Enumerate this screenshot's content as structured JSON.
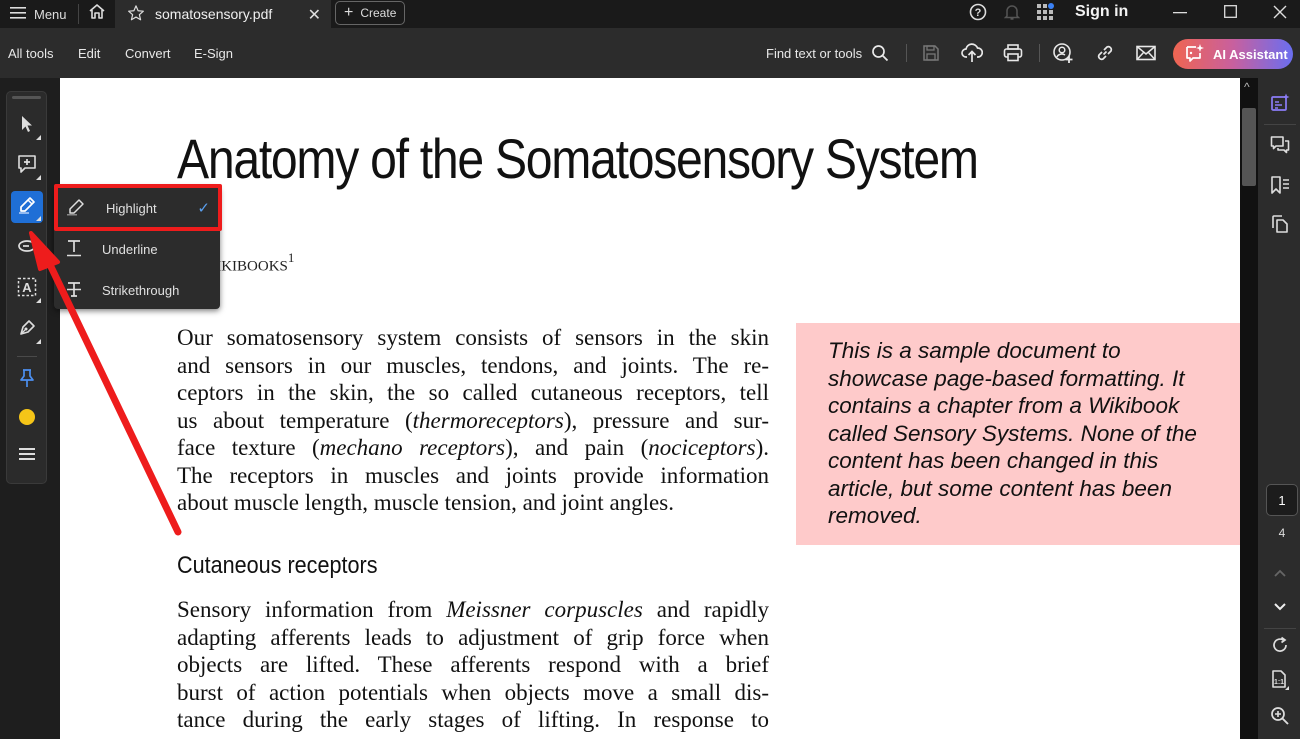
{
  "titlebar": {
    "menu_label": "Menu",
    "tab_title": "somatosensory.pdf",
    "create_label": "Create",
    "sign_in_label": "Sign in",
    "notification_dot_color": "#3b82f6"
  },
  "toolbar": {
    "menu_items": [
      "All tools",
      "Edit",
      "Convert",
      "E-Sign"
    ],
    "find_label": "Find text or tools",
    "ai_assistant_label": "AI Assistant"
  },
  "left_rail": {
    "tools": [
      {
        "name": "select",
        "icon": "cursor-arrow-icon"
      },
      {
        "name": "add-comment",
        "icon": "comment-plus-icon"
      },
      {
        "name": "highlight",
        "icon": "highlighter-pen-icon",
        "active": true
      },
      {
        "name": "draw-shape",
        "icon": "lasso-oval-icon"
      },
      {
        "name": "add-text",
        "icon": "text-box-icon"
      },
      {
        "name": "draw-freehand",
        "icon": "pen-draw-icon"
      },
      {
        "name": "pin",
        "icon": "pushpin-icon"
      },
      {
        "name": "color",
        "icon": "color-dot-icon",
        "color": "#f5c518"
      },
      {
        "name": "more",
        "icon": "menu-lines-icon"
      }
    ]
  },
  "popup_menu": {
    "items": [
      {
        "label": "Highlight",
        "icon": "highlighter-icon",
        "checked": true
      },
      {
        "label": "Underline",
        "icon": "underline-T-icon",
        "checked": false
      },
      {
        "label": "Strikethrough",
        "icon": "strikethrough-T-icon",
        "checked": false
      }
    ],
    "check_glyph": "✓"
  },
  "document": {
    "title": "Anatomy of the Somatosensory System",
    "author_visible": "m Wikibooks",
    "author_footnote": "1",
    "paragraph1_lines": [
      "Our somatosensory system consists of sensors in the skin",
      "and sensors in our muscles, tendons, and joints. The re-",
      "ceptors in the skin, the so called cutaneous receptors, tell",
      "us about temperature (thermoreceptors), pressure and sur-",
      "face texture (mechano receptors), and pain (nociceptors).",
      "The receptors in muscles and joints provide information",
      "about muscle length, muscle tension, and joint angles."
    ],
    "section_heading": "Cutaneous receptors",
    "paragraph2_lines": [
      "Sensory information from Meissner corpuscles and rapidly",
      "adapting afferents leads to adjustment of grip force when",
      "objects are lifted. These afferents respond with a brief",
      "burst of action potentials when objects move a small dis-",
      "tance during the early stages of lifting. In response to"
    ],
    "sidebox_lines": [
      "This is a sample document to",
      "showcase page-based formatting. It",
      "contains a chapter from a Wikibook",
      "called Sensory Systems. None of the",
      "content has been changed in this",
      "article, but some content has been",
      "removed."
    ],
    "sidebox_color": "#fecaca"
  },
  "navigation": {
    "current_page": "1",
    "total_pages": "4"
  },
  "annotation": {
    "color": "#ee1c1c"
  }
}
